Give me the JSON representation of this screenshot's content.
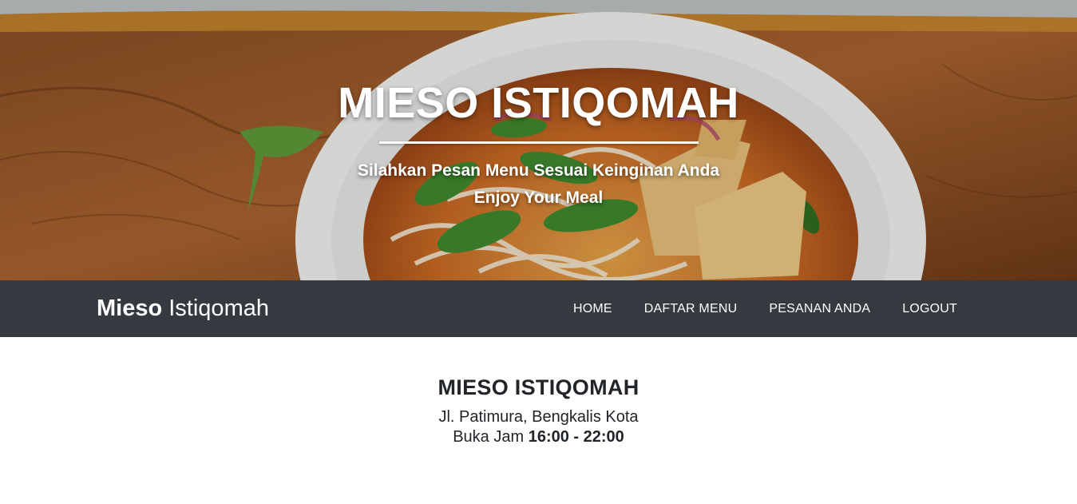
{
  "hero": {
    "title": "MIESO ISTIQOMAH",
    "subtitle_line1": "Silahkan Pesan Menu Sesuai Keinginan Anda",
    "subtitle_line2": "Enjoy Your Meal",
    "image": "noodle-soup-bowl-on-wooden-board"
  },
  "navbar": {
    "brand_bold": "Mieso",
    "brand_regular": "Istiqomah",
    "links": [
      "HOME",
      "DAFTAR MENU",
      "PESANAN ANDA",
      "LOGOUT"
    ],
    "background_color": "#343a40"
  },
  "info": {
    "title": "MIESO ISTIQOMAH",
    "address": "Jl. Patimura, Bengkalis Kota",
    "hours_label": "Buka Jam",
    "hours_value": "16:00 - 22:00"
  }
}
